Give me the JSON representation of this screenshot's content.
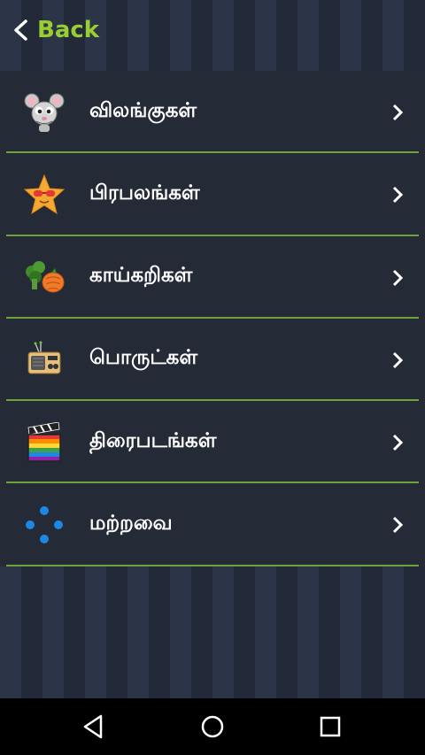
{
  "header": {
    "back_label": "Back"
  },
  "categories": [
    {
      "label": "விலங்குகள்",
      "icon": "mouse-icon"
    },
    {
      "label": "பிரபலங்கள்",
      "icon": "star-sunglasses-icon"
    },
    {
      "label": "காய்கறிகள்",
      "icon": "vegetables-icon"
    },
    {
      "label": "பொருட்கள்",
      "icon": "radio-icon"
    },
    {
      "label": "திரைபடங்கள்",
      "icon": "clapperboard-icon"
    },
    {
      "label": "மற்றவை",
      "icon": "dots-icon"
    }
  ],
  "navbar": {
    "items": [
      "back-nav-icon",
      "home-nav-icon",
      "recents-nav-icon"
    ]
  },
  "colors": {
    "accent": "#9acd32",
    "divider": "#6fa339",
    "background": "#273041",
    "text": "#ffffff"
  }
}
